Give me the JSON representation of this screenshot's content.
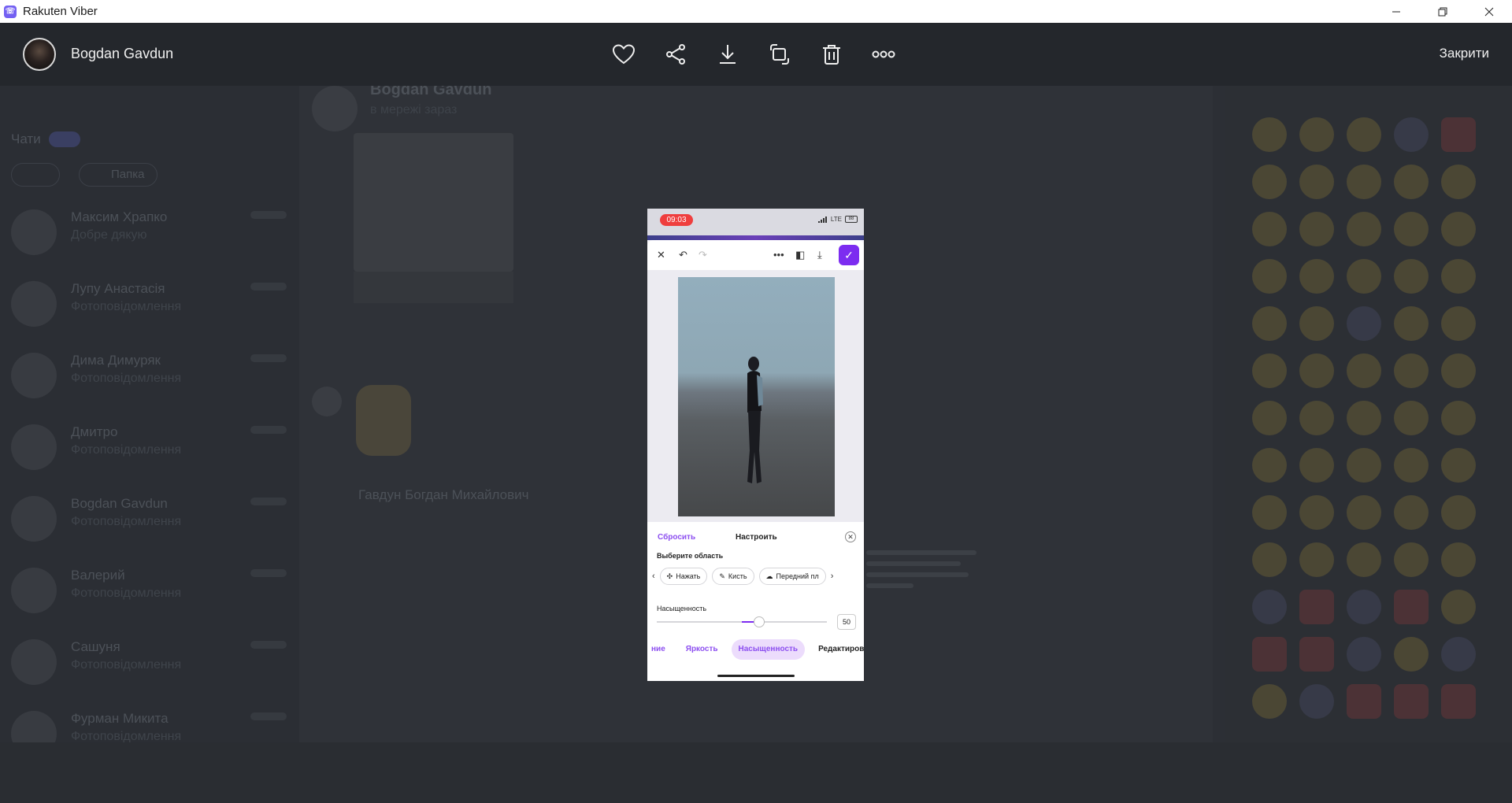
{
  "window": {
    "title": "Rakuten Viber"
  },
  "viewer": {
    "contact_name": "Bogdan Gavdun",
    "close_label": "Закрити",
    "actions": [
      "heart-icon",
      "share-icon",
      "download-icon",
      "rotate-icon",
      "trash-icon",
      "more-icon"
    ]
  },
  "background": {
    "chats_label": "Чати",
    "folder_label": "Папка",
    "chat_list": [
      {
        "name": "Максим Храпко",
        "preview": "Добре дякую"
      },
      {
        "name": "Лупу Анастасія",
        "preview": "Фотоповідомлення"
      },
      {
        "name": "Дима Димуряк",
        "preview": "Фотоповідомлення"
      },
      {
        "name": "Дмитро",
        "preview": "Фотоповідомлення"
      },
      {
        "name": "Bogdan Gavdun",
        "preview": "Фотоповідомлення"
      },
      {
        "name": "Валерий",
        "preview": "Фотоповідомлення"
      },
      {
        "name": "Сашуня",
        "preview": "Фотоповідомлення"
      },
      {
        "name": "Фурман Микита",
        "preview": "Фотоповідомлення"
      }
    ],
    "conversation_title": "Bogdan Gavdun",
    "conversation_subtitle": "в мережі зараз",
    "sender_name": "Гавдун Богдан Михайлович"
  },
  "phone": {
    "time": "09:03",
    "network": "LTE",
    "battery": "88",
    "panel": {
      "reset_label": "Сбросить",
      "title": "Настроить",
      "area_label": "Выберите область",
      "chips": [
        "Нажать",
        "Кисть",
        "Передний пл"
      ],
      "saturation_label": "Насыщенность",
      "saturation_value": "50",
      "saturation_fraction": 0.6
    },
    "tabs": [
      "ние",
      "Яркость",
      "Насыщенность",
      "Редактировать ц"
    ],
    "active_tab": "Насыщенность"
  },
  "colors": {
    "accent": "#7c2cf0",
    "viber_purple": "#7360f2",
    "toolbar_bg": "#24272c"
  }
}
